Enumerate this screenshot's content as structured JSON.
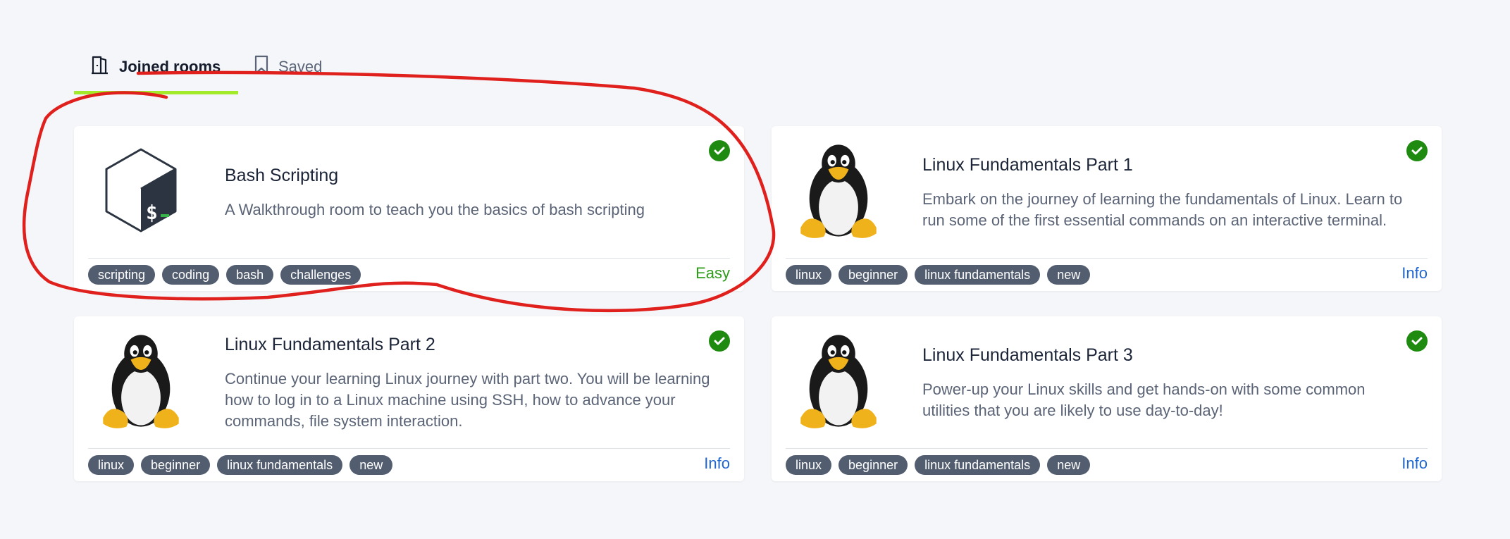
{
  "tabs": [
    {
      "label": "Joined rooms",
      "icon": "door-icon",
      "active": true
    },
    {
      "label": "Saved",
      "icon": "bookmark-icon",
      "active": false
    }
  ],
  "colors": {
    "tab_underline": "#a3ea2a",
    "check": "#1e8b10",
    "tag_bg": "#525d6f",
    "info_link": "#1f66d1",
    "easy": "#2e9c1a",
    "annotation": "#e0201c"
  },
  "rooms": [
    {
      "title": "Bash Scripting",
      "description": "A Walkthrough room to teach you the basics of bash scripting",
      "tags": [
        "scripting",
        "coding",
        "bash",
        "challenges"
      ],
      "right_label": "Easy",
      "icon": "bash-logo-icon",
      "completed": true
    },
    {
      "title": "Linux Fundamentals Part 1",
      "description": "Embark on the journey of learning the fundamentals of Linux. Learn to run some of the first essential commands on an interactive terminal.",
      "tags": [
        "linux",
        "beginner",
        "linux fundamentals",
        "new"
      ],
      "right_label": "Info",
      "icon": "tux-penguin-icon",
      "completed": true
    },
    {
      "title": "Linux Fundamentals Part 2",
      "description": "Continue your learning Linux journey with part two. You will be learning how to log in to a Linux machine using SSH, how to advance your commands, file system interaction.",
      "tags": [
        "linux",
        "beginner",
        "linux fundamentals",
        "new"
      ],
      "right_label": "Info",
      "icon": "tux-penguin-icon",
      "completed": true
    },
    {
      "title": "Linux Fundamentals Part 3",
      "description": "Power-up your Linux skills and get hands-on with some common utilities that you are likely to use day-to-day!",
      "tags": [
        "linux",
        "beginner",
        "linux fundamentals",
        "new"
      ],
      "right_label": "Info",
      "icon": "tux-penguin-icon",
      "completed": true
    }
  ]
}
